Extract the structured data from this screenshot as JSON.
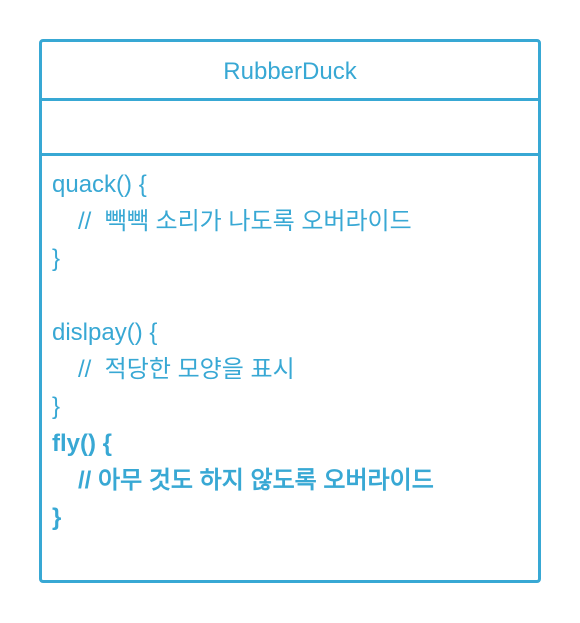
{
  "class_name": "RubberDuck",
  "methods": {
    "quack": {
      "signature": "quack() {",
      "comment": "//  빽빽 소리가 나도록 오버라이드",
      "close": "}"
    },
    "display": {
      "signature": "dislpay() {",
      "comment": "//  적당한 모양을 표시",
      "close": "}"
    },
    "fly": {
      "signature": "fly() {",
      "comment": "//  아무 것도 하지 않도록 오버라이드",
      "close": "}"
    }
  },
  "colors": {
    "accent": "#38a8d4",
    "background": "#ffffff"
  }
}
